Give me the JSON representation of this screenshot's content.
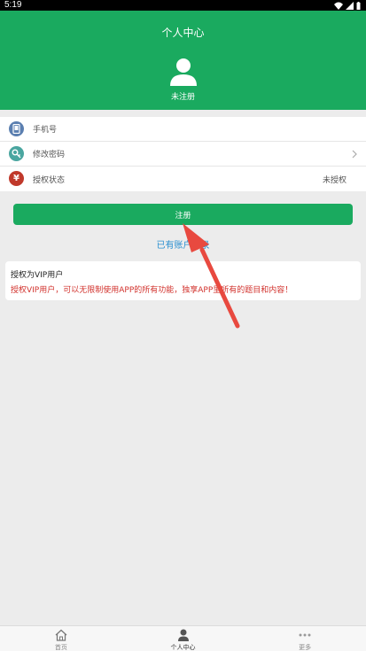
{
  "status_bar": {
    "time": "5:19"
  },
  "header": {
    "title": "个人中心",
    "user_status": "未注册"
  },
  "list": {
    "items": [
      {
        "label": "手机号",
        "value": "",
        "icon": "phone-icon",
        "icon_color": "#5b7fb0"
      },
      {
        "label": "修改密码",
        "value": "",
        "icon": "key-icon",
        "icon_color": "#4aa6a0"
      },
      {
        "label": "授权状态",
        "value": "未授权",
        "icon": "yen-icon",
        "icon_color": "#c0392b"
      }
    ]
  },
  "register_button": {
    "label": "注册"
  },
  "login_link": {
    "label": "已有账户登录"
  },
  "vip": {
    "title": "授权为VIP用户",
    "description": "授权VIP用户，可以无限制使用APP的所有功能，独享APP里所有的题目和内容！"
  },
  "tabbar": {
    "tabs": [
      {
        "label": "首页",
        "icon": "home-icon",
        "active": false
      },
      {
        "label": "个人中心",
        "icon": "person-icon",
        "active": true
      },
      {
        "label": "更多",
        "icon": "more-icon",
        "active": false
      }
    ]
  },
  "colors": {
    "primary": "#1aaa5f",
    "link": "#2a8fd0",
    "warning_text": "#d2322d",
    "annotation_arrow": "#e8493f"
  }
}
